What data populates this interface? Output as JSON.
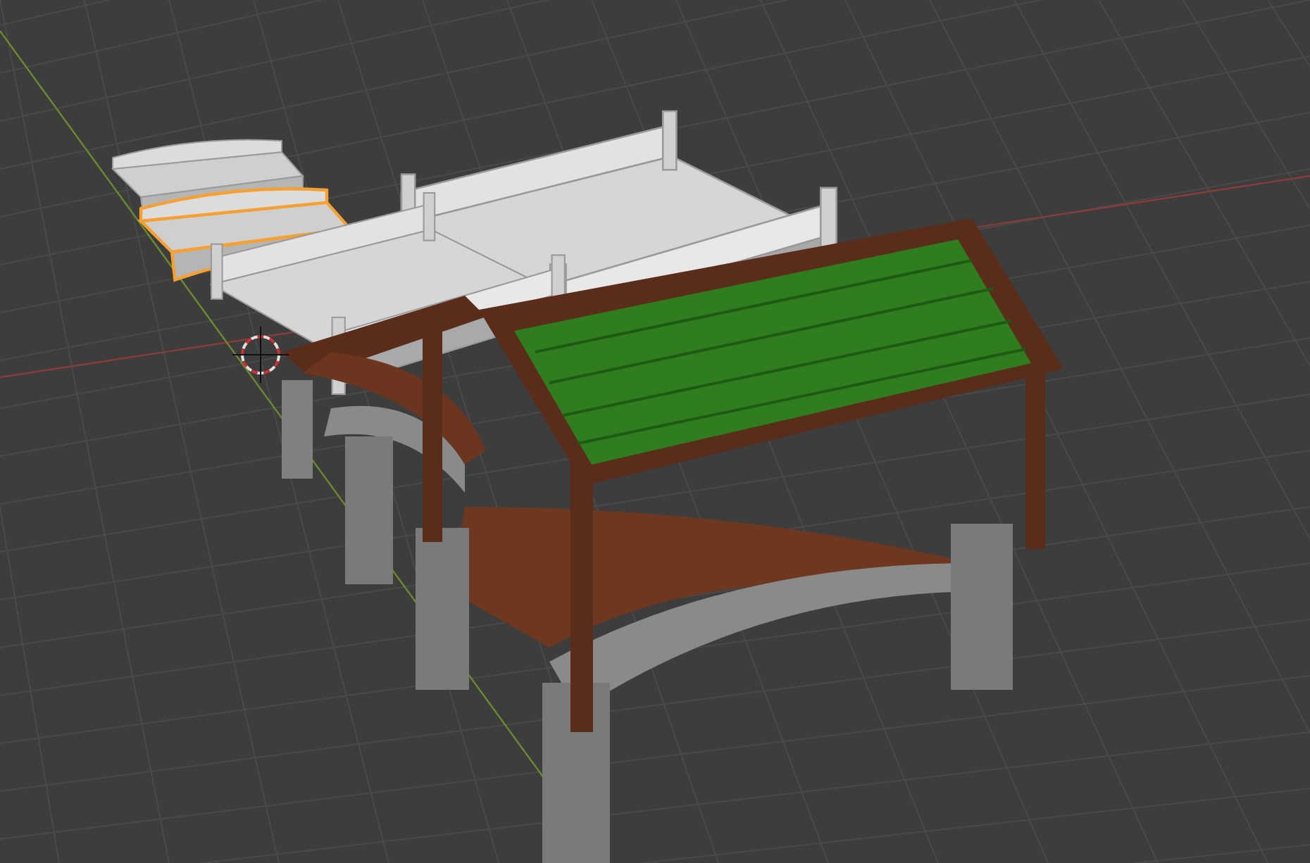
{
  "viewport": {
    "objects": [
      {
        "kind": "arch-bridge",
        "selected": false
      },
      {
        "kind": "arch-bridge",
        "selected": true
      },
      {
        "kind": "railed-bridge",
        "selected": false
      },
      {
        "kind": "railed-bridge",
        "selected": false
      },
      {
        "kind": "covered-bridge",
        "selected": false
      }
    ]
  }
}
